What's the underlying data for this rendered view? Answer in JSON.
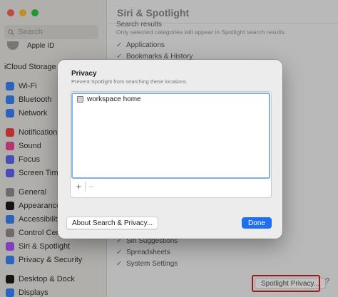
{
  "window": {
    "title": "Siri & Spotlight",
    "traffic_colors": [
      "#ff5f57",
      "#febc2e",
      "#28c840"
    ]
  },
  "sidebar": {
    "search_placeholder": "Search",
    "apple_id": "Apple ID",
    "icloud_label": "iCloud Storage Fu",
    "items": [
      {
        "label": "Wi-Fi",
        "icon": "wifi-icon",
        "color": "#3b82f6"
      },
      {
        "label": "Bluetooth",
        "icon": "bluetooth-icon",
        "color": "#3b82f6"
      },
      {
        "label": "Network",
        "icon": "globe-icon",
        "color": "#3b82f6"
      },
      {
        "label": "Notifications",
        "icon": "bell-icon",
        "color": "#ef4444"
      },
      {
        "label": "Sound",
        "icon": "speaker-icon",
        "color": "#ec4899"
      },
      {
        "label": "Focus",
        "icon": "moon-icon",
        "color": "#6366f1"
      },
      {
        "label": "Screen Time",
        "icon": "hourglass-icon",
        "color": "#6366f1"
      },
      {
        "label": "General",
        "icon": "gear-icon",
        "color": "#8e8e93"
      },
      {
        "label": "Appearance",
        "icon": "appearance-icon",
        "color": "#1c1c1e"
      },
      {
        "label": "Accessibility",
        "icon": "accessibility-icon",
        "color": "#3b82f6"
      },
      {
        "label": "Control Cente",
        "icon": "control-center-icon",
        "color": "#8e8e93"
      },
      {
        "label": "Siri & Spotlight",
        "icon": "siri-icon",
        "color": "#a855f7"
      },
      {
        "label": "Privacy & Security",
        "icon": "hand-icon",
        "color": "#3b82f6"
      },
      {
        "label": "Desktop & Dock",
        "icon": "dock-icon",
        "color": "#1c1c1e"
      },
      {
        "label": "Displays",
        "icon": "display-icon",
        "color": "#3b82f6"
      }
    ]
  },
  "content": {
    "section_heading": "Search results",
    "section_desc": "Only selected categories will appear in Spotlight search results.",
    "categories": [
      "Applications",
      "Bookmarks & History",
      "Siri Suggestions",
      "Spreadsheets",
      "System Settings"
    ],
    "spotlight_privacy_button": "Spotlight Privacy...",
    "help": "?"
  },
  "modal": {
    "title": "Privacy",
    "description": "Prevent Spotlight from searching these locations.",
    "locations": [
      "workspace home"
    ],
    "add": "+",
    "remove": "−",
    "about_button": "About Search & Privacy...",
    "done_button": "Done",
    "accent": "#1e6ff2"
  }
}
